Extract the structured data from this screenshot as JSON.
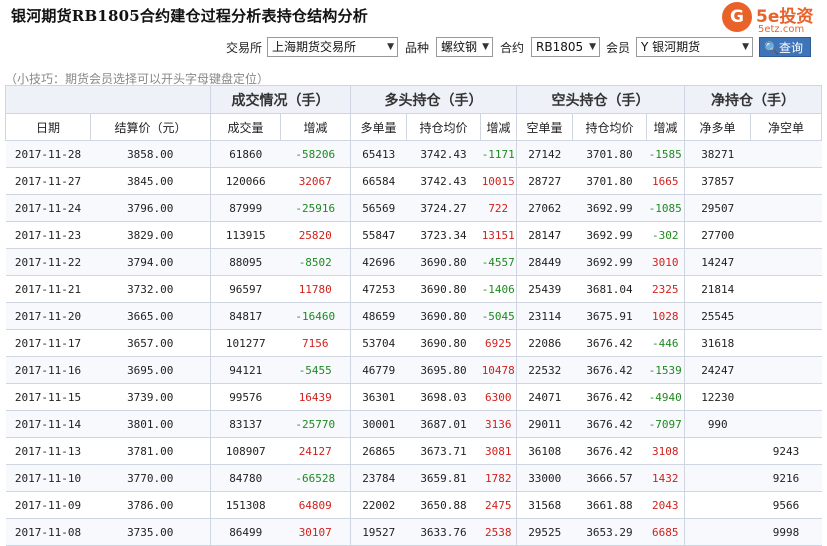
{
  "page": {
    "title": "银河期货RB1805合约建仓过程分析表持仓结构分析",
    "logo_mark": "G",
    "logo_name": "5e投资",
    "logo_url": "5etz.com"
  },
  "filters": {
    "exchange_label": "交易所",
    "exchange_value": "上海期货交易所",
    "variety_label": "品种",
    "variety_value": "螺纹钢",
    "contract_label": "合约",
    "contract_value": "RB1805",
    "member_label": "会员",
    "member_value": "Y 银河期货",
    "query_label": "查询",
    "query_icon": "search-icon"
  },
  "tip": "（小技巧：期货会员选择可以开头字母键盘定位）",
  "table": {
    "groups": [
      "成交情况（手）",
      "多头持仓（手）",
      "空头持仓（手）",
      "净持仓（手）"
    ],
    "columns": [
      "日期",
      "结算价（元）",
      "成交量",
      "增减",
      "多单量",
      "持仓均价",
      "增减",
      "空单量",
      "持仓均价",
      "增减",
      "净多单",
      "净空单"
    ],
    "rows": [
      [
        "2017-11-28",
        "3858.00",
        "61860",
        "-58206",
        "65413",
        "3742.43",
        "-1171",
        "27142",
        "3701.80",
        "-1585",
        "38271",
        ""
      ],
      [
        "2017-11-27",
        "3845.00",
        "120066",
        "32067",
        "66584",
        "3742.43",
        "10015",
        "28727",
        "3701.80",
        "1665",
        "37857",
        ""
      ],
      [
        "2017-11-24",
        "3796.00",
        "87999",
        "-25916",
        "56569",
        "3724.27",
        "722",
        "27062",
        "3692.99",
        "-1085",
        "29507",
        ""
      ],
      [
        "2017-11-23",
        "3829.00",
        "113915",
        "25820",
        "55847",
        "3723.34",
        "13151",
        "28147",
        "3692.99",
        "-302",
        "27700",
        ""
      ],
      [
        "2017-11-22",
        "3794.00",
        "88095",
        "-8502",
        "42696",
        "3690.80",
        "-4557",
        "28449",
        "3692.99",
        "3010",
        "14247",
        ""
      ],
      [
        "2017-11-21",
        "3732.00",
        "96597",
        "11780",
        "47253",
        "3690.80",
        "-1406",
        "25439",
        "3681.04",
        "2325",
        "21814",
        ""
      ],
      [
        "2017-11-20",
        "3665.00",
        "84817",
        "-16460",
        "48659",
        "3690.80",
        "-5045",
        "23114",
        "3675.91",
        "1028",
        "25545",
        ""
      ],
      [
        "2017-11-17",
        "3657.00",
        "101277",
        "7156",
        "53704",
        "3690.80",
        "6925",
        "22086",
        "3676.42",
        "-446",
        "31618",
        ""
      ],
      [
        "2017-11-16",
        "3695.00",
        "94121",
        "-5455",
        "46779",
        "3695.80",
        "10478",
        "22532",
        "3676.42",
        "-1539",
        "24247",
        ""
      ],
      [
        "2017-11-15",
        "3739.00",
        "99576",
        "16439",
        "36301",
        "3698.03",
        "6300",
        "24071",
        "3676.42",
        "-4940",
        "12230",
        ""
      ],
      [
        "2017-11-14",
        "3801.00",
        "83137",
        "-25770",
        "30001",
        "3687.01",
        "3136",
        "29011",
        "3676.42",
        "-7097",
        "990",
        ""
      ],
      [
        "2017-11-13",
        "3781.00",
        "108907",
        "24127",
        "26865",
        "3673.71",
        "3081",
        "36108",
        "3676.42",
        "3108",
        "",
        "9243"
      ],
      [
        "2017-11-10",
        "3770.00",
        "84780",
        "-66528",
        "23784",
        "3659.81",
        "1782",
        "33000",
        "3666.57",
        "1432",
        "",
        "9216"
      ],
      [
        "2017-11-09",
        "3786.00",
        "151308",
        "64809",
        "22002",
        "3650.88",
        "2475",
        "31568",
        "3661.88",
        "2043",
        "",
        "9566"
      ],
      [
        "2017-11-08",
        "3735.00",
        "86499",
        "30107",
        "19527",
        "3633.76",
        "2538",
        "29525",
        "3653.29",
        "6685",
        "",
        "9998"
      ]
    ]
  },
  "colors": {
    "positive": "#d0211c",
    "negative": "#1f8a1f",
    "header_bg": "#eef2f8",
    "button_bg": "#3f74b9",
    "logo": "#e8622a"
  }
}
